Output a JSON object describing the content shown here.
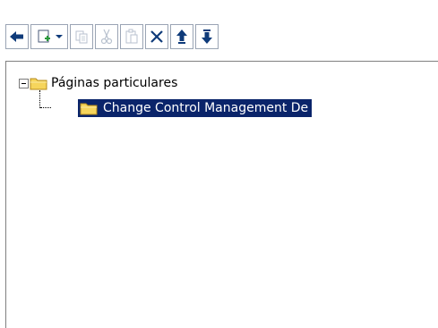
{
  "toolbar": {
    "buttons": [
      {
        "name": "back-button",
        "icon": "arrow-left-icon",
        "enabled": true
      },
      {
        "name": "new-page-button",
        "icon": "new-page-dropdown-icon",
        "enabled": true
      },
      {
        "name": "copy-button",
        "icon": "copy-icon",
        "enabled": false
      },
      {
        "name": "cut-button",
        "icon": "cut-icon",
        "enabled": false
      },
      {
        "name": "paste-button",
        "icon": "paste-icon",
        "enabled": false
      },
      {
        "name": "delete-button",
        "icon": "delete-icon",
        "enabled": true
      },
      {
        "name": "move-up-button",
        "icon": "arrow-up-icon",
        "enabled": true
      },
      {
        "name": "move-down-button",
        "icon": "arrow-down-icon",
        "enabled": true
      }
    ]
  },
  "tree": {
    "root": {
      "label": "Páginas particulares",
      "expanded": true,
      "icon": "folder-open-icon"
    },
    "children": [
      {
        "label": "Change Control Management De",
        "selected": true,
        "icon": "folder-icon"
      }
    ]
  },
  "colors": {
    "selection_bg": "#0a246a",
    "selection_text": "#ffffff",
    "folder_yellow": "#f6d55c",
    "button_border": "#9aa4b4",
    "icon_blue": "#0f3b7a"
  }
}
